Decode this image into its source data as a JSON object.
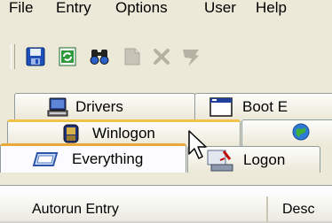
{
  "menu": {
    "items": [
      "File",
      "Entry",
      "Options",
      "User",
      "Help"
    ]
  },
  "toolbar": {
    "buttons": [
      "save-icon",
      "refresh-icon",
      "find-icon",
      "properties-icon",
      "delete-icon",
      "jump-icon"
    ]
  },
  "tabs": {
    "row1": [
      {
        "label": "Drivers",
        "icon": "drivers-icon"
      },
      {
        "label": "Boot E",
        "icon": "boot-execute-icon"
      }
    ],
    "row2": [
      {
        "label": "Winlogon",
        "icon": "winlogon-icon"
      },
      {
        "label": "",
        "icon": "globe-icon"
      }
    ],
    "row3": [
      {
        "label": "Everything",
        "icon": "everything-icon"
      },
      {
        "label": "Logon",
        "icon": "logon-icon"
      }
    ]
  },
  "columns": [
    "Autorun Entry",
    "Desc"
  ]
}
